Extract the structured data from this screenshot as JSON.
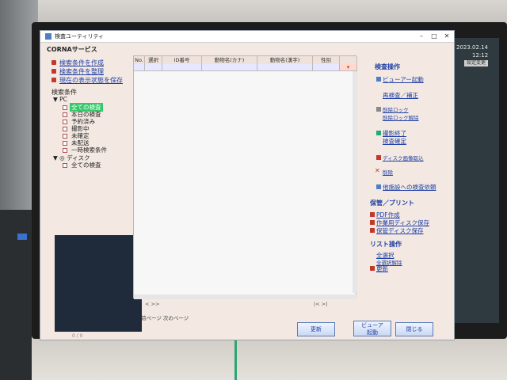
{
  "window": {
    "title": "検査ユーティリティ",
    "controls": [
      "–",
      "□",
      "✕"
    ],
    "app_name": "CORNAサービス"
  },
  "desktop": {
    "date": "2023.02.14",
    "time": "12:12",
    "setting_label": "設定変更"
  },
  "sidebar": {
    "links": [
      "検索条件を作成",
      "検索条件を整理",
      "現在の表示状態を保存"
    ],
    "conditions_header": "検索条件",
    "tree": [
      {
        "label": "PC",
        "type": "group"
      },
      {
        "label": "全ての検査",
        "selected": true
      },
      {
        "label": "本日の検査"
      },
      {
        "label": "予約済み"
      },
      {
        "label": "撮影中"
      },
      {
        "label": "未確定"
      },
      {
        "label": "未配送"
      },
      {
        "label": "一時検索条件"
      },
      {
        "label": "ディスク",
        "type": "group"
      },
      {
        "label": "全ての検査"
      }
    ],
    "panel_footer": "0 / 0"
  },
  "grid": {
    "columns": [
      "No.",
      "選択",
      "ID番号",
      "動物名(カナ)",
      "動物名(漢字)",
      "性別",
      ""
    ],
    "pager": "前ページ   次のページ",
    "nav_left": "<   >>",
    "nav_right": "|<   >|"
  },
  "right_panel": {
    "sections": [
      {
        "title": "検査操作",
        "items": [
          "ビューアー起動",
          "再検査／補正",
          "削除ロック",
          "削除ロック解除",
          "撮影終了",
          "検査確定",
          "ディスク画像取込",
          "削除",
          "他施設への検査依頼"
        ]
      },
      {
        "title": "保管／プリント",
        "items": [
          "PDF作成",
          "作業用ディスク保存",
          "保管ディスク保存"
        ]
      },
      {
        "title": "リスト操作",
        "items": [
          "全選択",
          "全選択解除",
          "更新"
        ]
      }
    ]
  },
  "buttons": {
    "refresh": "更新",
    "viewer_line1": "ビューア",
    "viewer_line2": "起動",
    "close": "閉じる"
  }
}
